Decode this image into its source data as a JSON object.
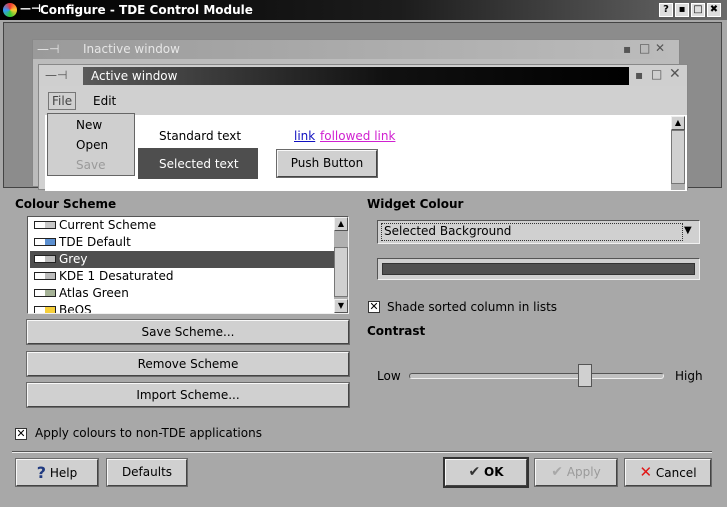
{
  "window": {
    "title": "Configure - TDE Control Module",
    "help_btn": "?",
    "min_btn": "▪",
    "max_btn": "□",
    "close_btn": "✖"
  },
  "preview": {
    "inactive_title": "Inactive window",
    "active_title": "Active window",
    "menu_file": "File",
    "menu_edit": "Edit",
    "menu_items": [
      "New",
      "Open",
      "Save"
    ],
    "standard_text": "Standard text",
    "link": "link",
    "followed_link": "followed link",
    "selected_text": "Selected text",
    "push_button": "Push Button"
  },
  "colour_scheme": {
    "label": "Colour Scheme",
    "items": [
      {
        "name": "Current Scheme",
        "swatch": "#c8c8c8"
      },
      {
        "name": "TDE Default",
        "swatch": "#5b8fd0"
      },
      {
        "name": "Grey",
        "swatch": "#bdbdbd"
      },
      {
        "name": "KDE 1 Desaturated",
        "swatch": "#bcbcbc"
      },
      {
        "name": "Atlas Green",
        "swatch": "#a5b296"
      },
      {
        "name": "BeOS",
        "swatch": "#f7d03a"
      }
    ],
    "selected": "Grey",
    "save_btn": "Save Scheme...",
    "remove_btn": "Remove Scheme",
    "import_btn": "Import Scheme..."
  },
  "widget_colour": {
    "label": "Widget Colour",
    "selected": "Selected Background",
    "swatch_color": "#505050",
    "shade_sorted": "Shade sorted column in lists",
    "shade_checked": true
  },
  "contrast": {
    "label": "Contrast",
    "low": "Low",
    "high": "High",
    "value_fraction": 0.7
  },
  "apply_nontde": {
    "label": "Apply colours to non-TDE applications",
    "checked": true
  },
  "footer": {
    "help": "Help",
    "defaults": "Defaults",
    "ok": "OK",
    "apply": "Apply",
    "cancel": "Cancel"
  }
}
